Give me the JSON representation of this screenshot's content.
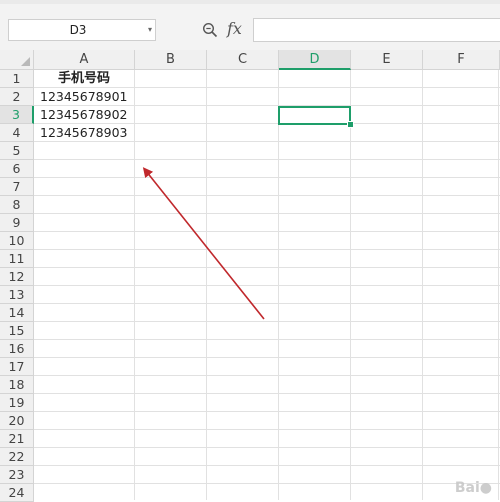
{
  "formula_bar": {
    "name_box": "D3",
    "fx_label": "fx",
    "formula_value": ""
  },
  "sheet": {
    "columns": [
      "A",
      "B",
      "C",
      "D",
      "E",
      "F"
    ],
    "active_column": "D",
    "rows": [
      "1",
      "2",
      "3",
      "4",
      "5",
      "6",
      "7",
      "8",
      "9",
      "10",
      "11",
      "12",
      "13",
      "14",
      "15",
      "16",
      "17",
      "18",
      "19",
      "20",
      "21",
      "22",
      "23",
      "24"
    ],
    "active_row": "3",
    "cells": {
      "A1": "手机号码",
      "A2": "12345678901",
      "A3": "12345678902",
      "A4": "12345678903"
    }
  },
  "annotation": {
    "arrow_color": "#c0282c"
  },
  "accent_color": "#1e9e6a",
  "icons": {
    "zoom": "zoom-icon",
    "dropdown": "chevron-down-icon"
  }
}
